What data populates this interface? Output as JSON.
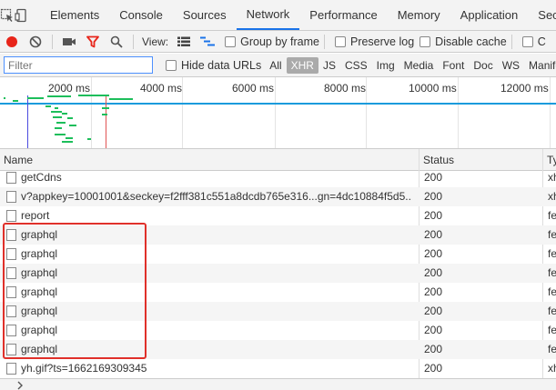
{
  "tabs": [
    "Elements",
    "Console",
    "Sources",
    "Network",
    "Performance",
    "Memory",
    "Application",
    "Sec"
  ],
  "active_tab": "Network",
  "toolbar": {
    "view_label": "View:",
    "group_by_frame": "Group by frame",
    "preserve_log": "Preserve log",
    "disable_cache": "Disable cache",
    "offline_partial": "C"
  },
  "filter": {
    "placeholder": "Filter",
    "hide_data_urls": "Hide data URLs",
    "types": [
      "All",
      "XHR",
      "JS",
      "CSS",
      "Img",
      "Media",
      "Font",
      "Doc",
      "WS",
      "Manifest"
    ],
    "active_type": "XHR"
  },
  "overview": {
    "tick_labels": [
      "2000 ms",
      "4000 ms",
      "6000 ms",
      "8000 ms",
      "10000 ms",
      "12000 ms"
    ]
  },
  "table": {
    "headers": {
      "name": "Name",
      "status": "Status",
      "type": "Ty"
    },
    "rows": [
      {
        "name": "getCdns",
        "status": "200",
        "type": "xh"
      },
      {
        "name": "v?appkey=10001001&seckey=f2fff381c551a8dcdb765e316...gn=4dc10884f5d5...",
        "status": "200",
        "type": "xh"
      },
      {
        "name": "report",
        "status": "200",
        "type": "fe"
      },
      {
        "name": "graphql",
        "status": "200",
        "type": "fe"
      },
      {
        "name": "graphql",
        "status": "200",
        "type": "fe"
      },
      {
        "name": "graphql",
        "status": "200",
        "type": "fe"
      },
      {
        "name": "graphql",
        "status": "200",
        "type": "fe"
      },
      {
        "name": "graphql",
        "status": "200",
        "type": "fe"
      },
      {
        "name": "graphql",
        "status": "200",
        "type": "fe"
      },
      {
        "name": "graphql",
        "status": "200",
        "type": "fe"
      },
      {
        "name": "yh.gif?ts=1662169309345",
        "status": "200",
        "type": "xh"
      }
    ]
  },
  "colors": {
    "accent": "#1a73e8",
    "record": "#e8251a",
    "highlight": "#e0302a",
    "waterfall": "#1dbe5b"
  }
}
